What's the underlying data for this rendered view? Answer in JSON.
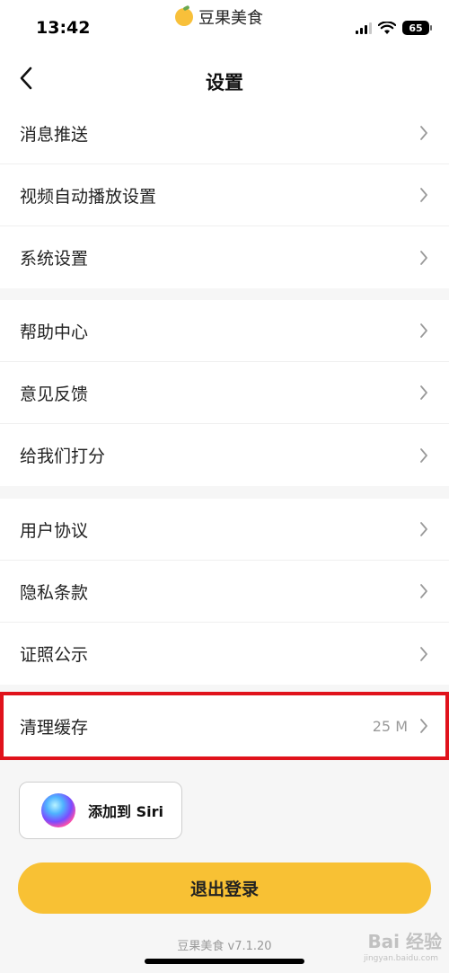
{
  "status_bar": {
    "time": "13:42",
    "app_badge": "豆果美食",
    "battery": "65"
  },
  "nav": {
    "title": "设置"
  },
  "groups": [
    {
      "items": [
        {
          "label": "消息推送"
        },
        {
          "label": "视频自动播放设置"
        },
        {
          "label": "系统设置"
        }
      ]
    },
    {
      "items": [
        {
          "label": "帮助中心"
        },
        {
          "label": "意见反馈"
        },
        {
          "label": "给我们打分"
        }
      ]
    },
    {
      "items": [
        {
          "label": "用户协议"
        },
        {
          "label": "隐私条款"
        },
        {
          "label": "证照公示"
        }
      ]
    },
    {
      "items": [
        {
          "label": "清理缓存",
          "value": "25 M"
        }
      ]
    }
  ],
  "siri_button": {
    "label": "添加到 Siri"
  },
  "logout_button": {
    "label": "退出登录"
  },
  "footer": {
    "version": "豆果美食 v7.1.20"
  },
  "watermark": {
    "text": "Bai 经验",
    "sub": "jingyan.baidu.com"
  },
  "colors": {
    "accent": "#f8c134",
    "highlight": "#e0121b",
    "background": "#f6f6f6"
  }
}
